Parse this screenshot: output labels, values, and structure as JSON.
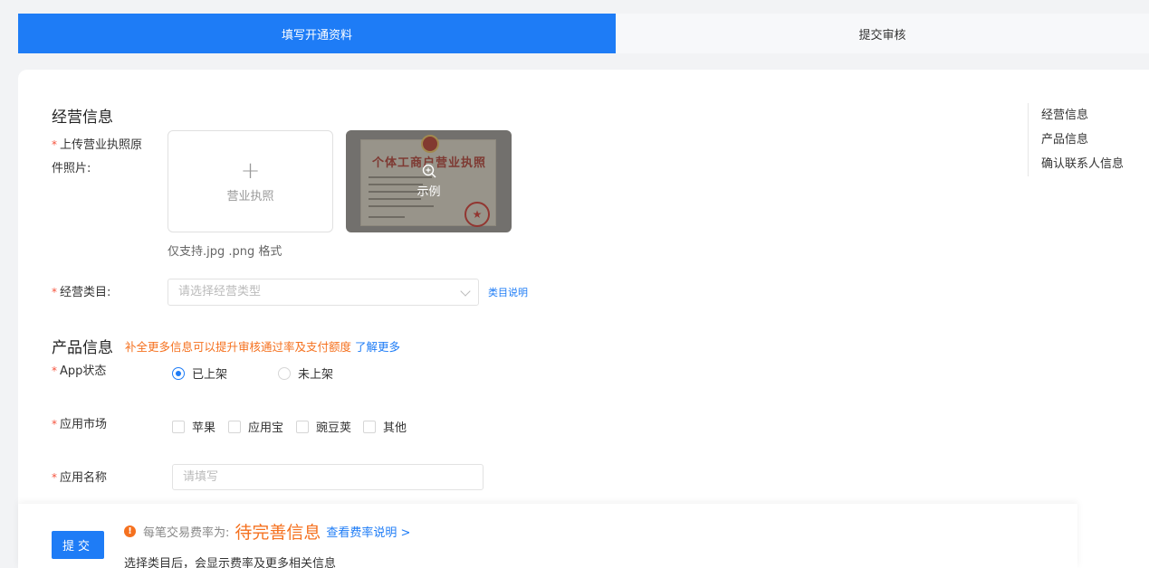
{
  "steps": [
    {
      "label": "填写开通资料",
      "active": true
    },
    {
      "label": "提交审核",
      "active": false
    }
  ],
  "business": {
    "section_title": "经营信息",
    "license_label_line1": "上传营业执照原",
    "license_label_line2": "件照片:",
    "upload_plus": "+",
    "upload_text": "营业执照",
    "example_text": "示例",
    "example_license_title": "个体工商户营业执照",
    "example_seal": "★",
    "hint": "仅支持.jpg .png 格式",
    "category_label": "经营类目:",
    "category_placeholder": "请选择经营类型",
    "category_link": "类目说明",
    "required_mark": "*"
  },
  "product": {
    "section_title": "产品信息",
    "tip": "补全更多信息可以提升审核通过率及支付额度",
    "tip_link": "了解更多",
    "app_status_label": "App状态",
    "status_options": [
      {
        "label": "已上架",
        "checked": true
      },
      {
        "label": "未上架",
        "checked": false
      }
    ],
    "market_label": "应用市场",
    "markets": [
      "苹果",
      "应用宝",
      "豌豆荚",
      "其他"
    ],
    "app_name_label": "应用名称",
    "app_name_placeholder": "请填写"
  },
  "anchor_nav": [
    "经营信息",
    "产品信息",
    "确认联系人信息"
  ],
  "footer": {
    "submit_label": "提交",
    "info_icon": "!",
    "fee_label": "每笔交易费率为:",
    "fee_value": "待完善信息",
    "fee_link": "查看费率说明 >",
    "sub_text": "选择类目后，会显示费率及更多相关信息"
  },
  "colors": {
    "primary": "#1e7cf6",
    "warning": "#f5711f",
    "required": "#f5533d"
  }
}
